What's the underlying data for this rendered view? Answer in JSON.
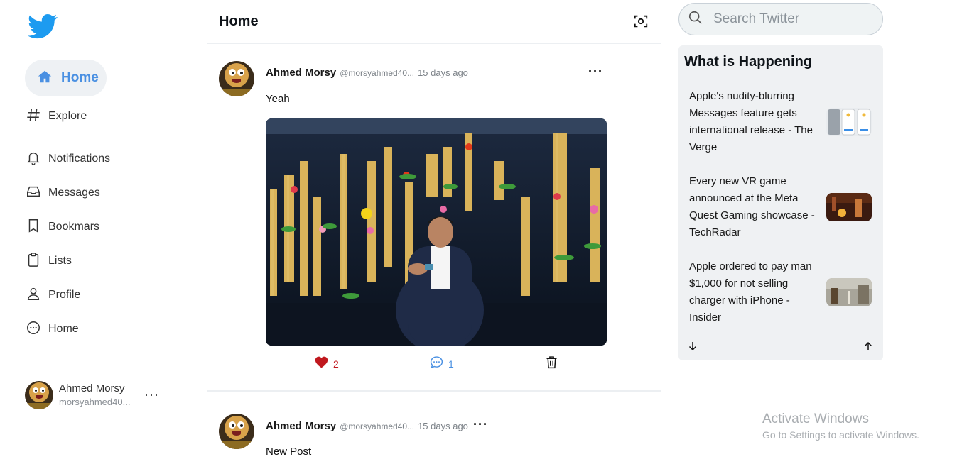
{
  "colors": {
    "accent": "#4a90e2",
    "like": "#c0181e",
    "comment": "#4a90e2",
    "panel_bg": "#eff1f3"
  },
  "sidebar": {
    "logo_icon": "twitter-bird-icon",
    "items": [
      {
        "label": "Home",
        "icon": "home-icon",
        "active": true
      },
      {
        "label": "Explore",
        "icon": "hashtag-icon"
      },
      {
        "label": "Notifications",
        "icon": "bell-icon"
      },
      {
        "label": "Messages",
        "icon": "inbox-icon"
      },
      {
        "label": "Bookmars",
        "icon": "bookmark-icon"
      },
      {
        "label": "Lists",
        "icon": "clipboard-icon"
      },
      {
        "label": "Profile",
        "icon": "user-icon"
      },
      {
        "label": "Home",
        "icon": "more-circle-icon"
      }
    ],
    "account": {
      "name": "Ahmed Morsy",
      "handle": "morsyahmed40...",
      "more": "···"
    }
  },
  "feed": {
    "title": "Home",
    "tweets": [
      {
        "name": "Ahmed Morsy",
        "handle": "@morsyahmed40...",
        "time": "15 days ago",
        "text": "Yeah",
        "likes": "2",
        "comments": "1",
        "has_image": true
      },
      {
        "name": "Ahmed Morsy",
        "handle": "@morsyahmed40...",
        "time": "15 days ago",
        "text": "New Post"
      }
    ]
  },
  "search": {
    "placeholder": "Search Twitter"
  },
  "trends": {
    "title": "What is Happening",
    "items": [
      {
        "text": "Apple's nudity-blurring Messages feature gets international release - The Verge"
      },
      {
        "text": "Every new VR game announced at the Meta Quest Gaming showcase - TechRadar"
      },
      {
        "text": "Apple ordered to pay man $1,000 for not selling charger with iPhone - Insider"
      }
    ]
  },
  "watermark": {
    "line1": "Activate Windows",
    "line2": "Go to Settings to activate Windows."
  }
}
